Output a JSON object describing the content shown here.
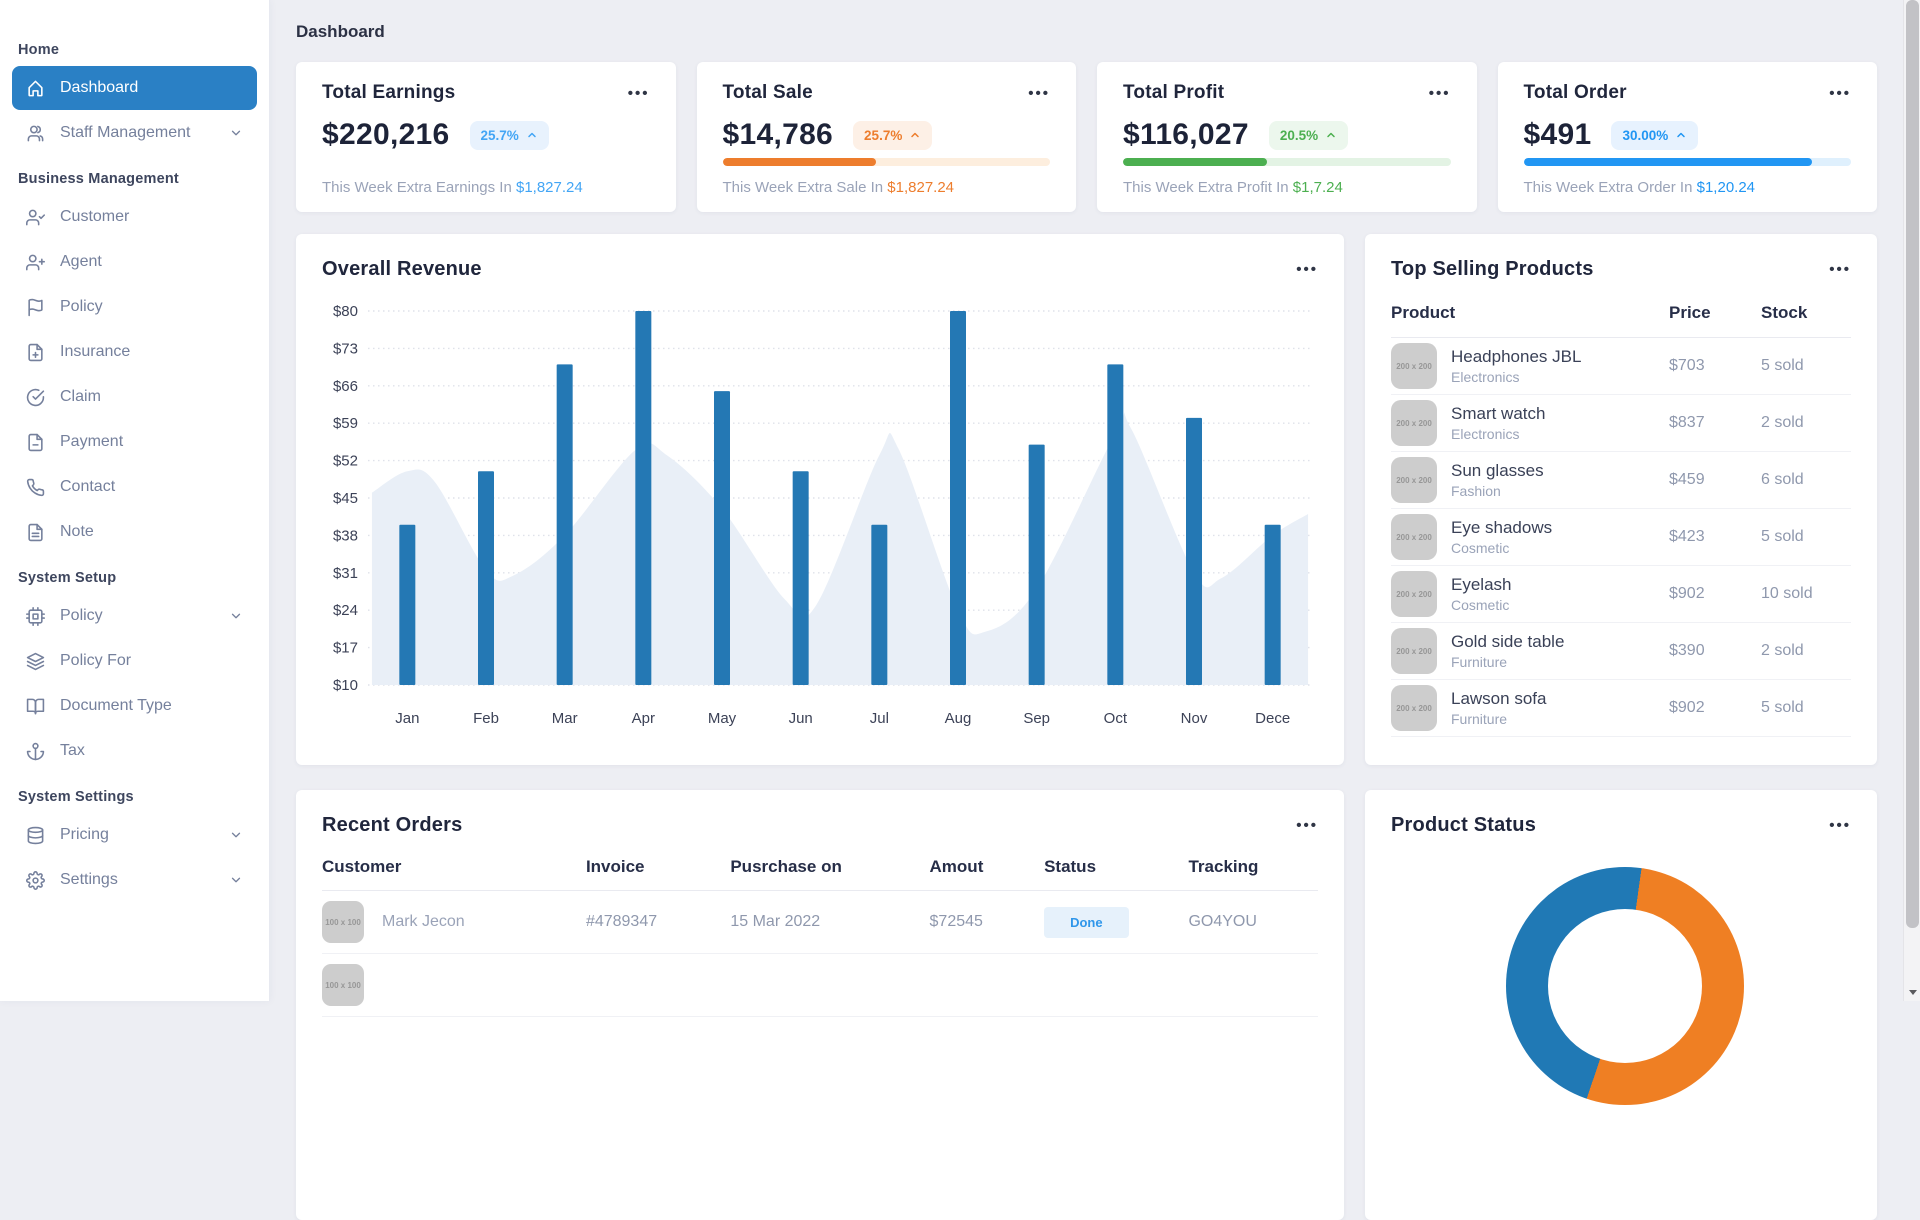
{
  "page": {
    "heading": "Dashboard"
  },
  "menu_dots": "•••",
  "sidebar": {
    "sections": [
      {
        "label": "Home",
        "items": [
          {
            "label": "Dashboard",
            "icon": "home",
            "active": true,
            "chevron": false
          },
          {
            "label": "Staff Management",
            "icon": "users",
            "active": false,
            "chevron": true
          }
        ]
      },
      {
        "label": "Business Management",
        "items": [
          {
            "label": "Customer",
            "icon": "user-check",
            "active": false,
            "chevron": false
          },
          {
            "label": "Agent",
            "icon": "user-plus",
            "active": false,
            "chevron": false
          },
          {
            "label": "Policy",
            "icon": "flag",
            "active": false,
            "chevron": false
          },
          {
            "label": "Insurance",
            "icon": "file-plus",
            "active": false,
            "chevron": false
          },
          {
            "label": "Claim",
            "icon": "check-circle",
            "active": false,
            "chevron": false
          },
          {
            "label": "Payment",
            "icon": "file-minus",
            "active": false,
            "chevron": false
          },
          {
            "label": "Contact",
            "icon": "phone",
            "active": false,
            "chevron": false
          },
          {
            "label": "Note",
            "icon": "file-text",
            "active": false,
            "chevron": false
          }
        ]
      },
      {
        "label": "System Setup",
        "items": [
          {
            "label": "Policy",
            "icon": "cpu",
            "active": false,
            "chevron": true
          },
          {
            "label": "Policy For",
            "icon": "layers",
            "active": false,
            "chevron": false
          },
          {
            "label": "Document Type",
            "icon": "book-open",
            "active": false,
            "chevron": false
          },
          {
            "label": "Tax",
            "icon": "anchor",
            "active": false,
            "chevron": false
          }
        ]
      },
      {
        "label": "System Settings",
        "items": [
          {
            "label": "Pricing",
            "icon": "database",
            "active": false,
            "chevron": true
          },
          {
            "label": "Settings",
            "icon": "gear",
            "active": false,
            "chevron": true
          }
        ]
      }
    ]
  },
  "stats": [
    {
      "title": "Total Earnings",
      "value": "$220,216",
      "badge": "25.7%",
      "subtext": "This Week Extra Earnings In",
      "amount": "$1,827.24",
      "color": "#42a5f5",
      "badge_bg": "#e8f2fd",
      "progress": null,
      "track": null
    },
    {
      "title": "Total Sale",
      "value": "$14,786",
      "badge": "25.7%",
      "subtext": "This Week Extra Sale In",
      "amount": "$1,827.24",
      "color": "#ed7d2d",
      "badge_bg": "#fdf0e6",
      "progress": 47,
      "track": "#fdeede"
    },
    {
      "title": "Total Profit",
      "value": "$116,027",
      "badge": "20.5%",
      "subtext": "This Week Extra Profit In",
      "amount": "$1,7.24",
      "color": "#4caf50",
      "badge_bg": "#ecf7ed",
      "progress": 44,
      "track": "#e3f3e4"
    },
    {
      "title": "Total Order",
      "value": "$491",
      "badge": "30.00%",
      "subtext": "This Week Extra Order In",
      "amount": "$1,20.24",
      "color": "#2196f3",
      "badge_bg": "#e7f2fe",
      "progress": 88,
      "track": "#dff0fd"
    }
  ],
  "revenue_panel": {
    "title": "Overall Revenue"
  },
  "products_panel": {
    "title": "Top Selling Products",
    "headers": [
      "Product",
      "Price",
      "Stock"
    ],
    "image_placeholder": "200 x 200",
    "rows": [
      {
        "name": "Headphones JBL",
        "category": "Electronics",
        "price": "$703",
        "stock": "5 sold"
      },
      {
        "name": "Smart watch",
        "category": "Electronics",
        "price": "$837",
        "stock": "2 sold"
      },
      {
        "name": "Sun glasses",
        "category": "Fashion",
        "price": "$459",
        "stock": "6 sold"
      },
      {
        "name": "Eye shadows",
        "category": "Cosmetic",
        "price": "$423",
        "stock": "5 sold"
      },
      {
        "name": "Eyelash",
        "category": "Cosmetic",
        "price": "$902",
        "stock": "10 sold"
      },
      {
        "name": "Gold side table",
        "category": "Furniture",
        "price": "$390",
        "stock": "2 sold"
      },
      {
        "name": "Lawson sofa",
        "category": "Furniture",
        "price": "$902",
        "stock": "5 sold"
      }
    ]
  },
  "orders_panel": {
    "title": "Recent Orders",
    "headers": [
      "Customer",
      "Invoice",
      "Pusrchase on",
      "Amout",
      "Status",
      "Tracking"
    ],
    "image_placeholder": "100 x 100",
    "rows": [
      {
        "customer": "Mark Jecon",
        "invoice": "#4789347",
        "purchase_on": "15 Mar 2022",
        "amount": "$72545",
        "status": "Done",
        "tracking": "GO4YOU"
      },
      {
        "customer": "",
        "invoice": "",
        "purchase_on": "",
        "amount": "",
        "status": "",
        "tracking": ""
      }
    ]
  },
  "status_panel": {
    "title": "Product Status"
  },
  "chart_data": [
    {
      "type": "bar",
      "title": "Overall Revenue",
      "categories": [
        "Jan",
        "Feb",
        "Mar",
        "Apr",
        "May",
        "Jun",
        "Jul",
        "Aug",
        "Sep",
        "Oct",
        "Nov",
        "Dece"
      ],
      "series": [
        {
          "name": "Monthly Revenue",
          "type": "bar",
          "color": "#2478b4",
          "values": [
            40,
            50,
            70,
            80,
            65,
            50,
            40,
            80,
            55,
            70,
            60,
            40
          ]
        },
        {
          "name": "Trend (background area)",
          "type": "area",
          "color": "#e9eff7",
          "points": [
            [
              -0.45,
              46
            ],
            [
              0,
              50
            ],
            [
              0.35,
              48
            ],
            [
              1,
              31.5
            ],
            [
              1.35,
              30.5
            ],
            [
              2,
              38
            ],
            [
              2.9,
              54
            ],
            [
              3.3,
              53
            ],
            [
              4,
              43
            ],
            [
              4.8,
              26
            ],
            [
              5.2,
              25
            ],
            [
              6,
              53
            ],
            [
              6.25,
              54
            ],
            [
              7,
              24
            ],
            [
              7.35,
              20
            ],
            [
              8,
              28
            ],
            [
              9,
              57
            ],
            [
              9.2,
              58
            ],
            [
              10,
              31
            ],
            [
              10.35,
              30
            ],
            [
              11,
              38
            ],
            [
              11.45,
              42
            ]
          ]
        }
      ],
      "yticks": [
        "$80",
        "$73",
        "$66",
        "$59",
        "$52",
        "$45",
        "$38",
        "$31",
        "$24",
        "$17",
        "$10"
      ],
      "ylim": [
        10,
        80
      ],
      "ytick_step": 7,
      "xlabel": "",
      "ylabel": "",
      "grid": "dotted horizontal",
      "legend": "none"
    },
    {
      "type": "pie",
      "title": "Product Status",
      "donut": true,
      "rotation_deg": 8,
      "slices": [
        {
          "label": "",
          "value": 53,
          "color": "#ef7f23"
        },
        {
          "label": "",
          "value": 47,
          "color": "#2079b5"
        }
      ],
      "note": "chart partially cut off by viewport; blue left segment, orange right segment"
    }
  ]
}
